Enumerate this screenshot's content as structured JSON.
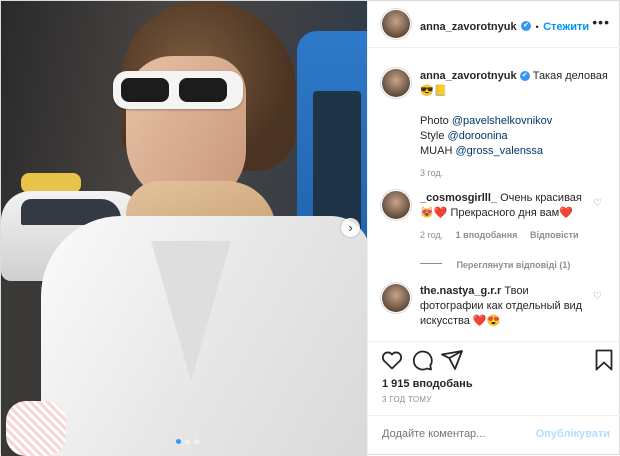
{
  "post": {
    "username": "anna_zavorotnyuk",
    "follow_label": "Стежити",
    "more_label": "•••",
    "verified_icon": "✔"
  },
  "caption": {
    "text": "Такая деловая",
    "emoji": "😎📒",
    "photo_prefix": "Photo",
    "photo_user": "@pavelshelkovnikov",
    "style_prefix": "Style",
    "style_user": "@doroonina",
    "muah_prefix": "MUAH",
    "muah_user": "@gross_valenssa",
    "time": "3 год."
  },
  "comments": [
    {
      "username": "_cosmosgirlll_",
      "text": "Очень красивая",
      "text2": "😻❤️ Прекрасного дня вам❤️",
      "time": "2 год.",
      "likes": "1 вподобання",
      "reply": "Відповісти",
      "view_replies": "Переглянути відповіді (1)"
    },
    {
      "username": "the.nastya_g.r.r",
      "text": "Твои",
      "text2": "фотографии как отдельный вид",
      "text3": "искусства ❤️😍"
    }
  ],
  "actions": {
    "like_icon": "heart-icon",
    "comment_icon": "comment-icon",
    "share_icon": "share-icon",
    "save_icon": "bookmark-icon"
  },
  "likes_count": "1 915 вподобань",
  "posted_ago": "3 ГОД ТОМУ",
  "add_comment": {
    "placeholder": "Додайте коментар...",
    "publish_label": "Опублікувати"
  },
  "carousel": {
    "next_label": "›",
    "slides": 3,
    "active_slide": 1
  },
  "colors": {
    "accent": "#0095f6",
    "verified": "#3897f0",
    "muted": "#8e8e8e",
    "link": "#00376b"
  }
}
